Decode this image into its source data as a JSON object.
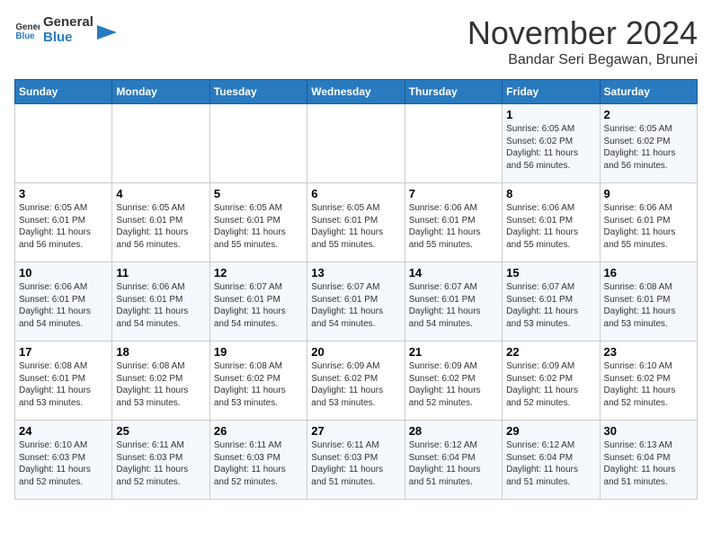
{
  "header": {
    "logo_line1": "General",
    "logo_line2": "Blue",
    "month": "November 2024",
    "location": "Bandar Seri Begawan, Brunei"
  },
  "weekdays": [
    "Sunday",
    "Monday",
    "Tuesday",
    "Wednesday",
    "Thursday",
    "Friday",
    "Saturday"
  ],
  "weeks": [
    [
      {
        "day": "",
        "info": ""
      },
      {
        "day": "",
        "info": ""
      },
      {
        "day": "",
        "info": ""
      },
      {
        "day": "",
        "info": ""
      },
      {
        "day": "",
        "info": ""
      },
      {
        "day": "1",
        "info": "Sunrise: 6:05 AM\nSunset: 6:02 PM\nDaylight: 11 hours\nand 56 minutes."
      },
      {
        "day": "2",
        "info": "Sunrise: 6:05 AM\nSunset: 6:02 PM\nDaylight: 11 hours\nand 56 minutes."
      }
    ],
    [
      {
        "day": "3",
        "info": "Sunrise: 6:05 AM\nSunset: 6:01 PM\nDaylight: 11 hours\nand 56 minutes."
      },
      {
        "day": "4",
        "info": "Sunrise: 6:05 AM\nSunset: 6:01 PM\nDaylight: 11 hours\nand 56 minutes."
      },
      {
        "day": "5",
        "info": "Sunrise: 6:05 AM\nSunset: 6:01 PM\nDaylight: 11 hours\nand 55 minutes."
      },
      {
        "day": "6",
        "info": "Sunrise: 6:05 AM\nSunset: 6:01 PM\nDaylight: 11 hours\nand 55 minutes."
      },
      {
        "day": "7",
        "info": "Sunrise: 6:06 AM\nSunset: 6:01 PM\nDaylight: 11 hours\nand 55 minutes."
      },
      {
        "day": "8",
        "info": "Sunrise: 6:06 AM\nSunset: 6:01 PM\nDaylight: 11 hours\nand 55 minutes."
      },
      {
        "day": "9",
        "info": "Sunrise: 6:06 AM\nSunset: 6:01 PM\nDaylight: 11 hours\nand 55 minutes."
      }
    ],
    [
      {
        "day": "10",
        "info": "Sunrise: 6:06 AM\nSunset: 6:01 PM\nDaylight: 11 hours\nand 54 minutes."
      },
      {
        "day": "11",
        "info": "Sunrise: 6:06 AM\nSunset: 6:01 PM\nDaylight: 11 hours\nand 54 minutes."
      },
      {
        "day": "12",
        "info": "Sunrise: 6:07 AM\nSunset: 6:01 PM\nDaylight: 11 hours\nand 54 minutes."
      },
      {
        "day": "13",
        "info": "Sunrise: 6:07 AM\nSunset: 6:01 PM\nDaylight: 11 hours\nand 54 minutes."
      },
      {
        "day": "14",
        "info": "Sunrise: 6:07 AM\nSunset: 6:01 PM\nDaylight: 11 hours\nand 54 minutes."
      },
      {
        "day": "15",
        "info": "Sunrise: 6:07 AM\nSunset: 6:01 PM\nDaylight: 11 hours\nand 53 minutes."
      },
      {
        "day": "16",
        "info": "Sunrise: 6:08 AM\nSunset: 6:01 PM\nDaylight: 11 hours\nand 53 minutes."
      }
    ],
    [
      {
        "day": "17",
        "info": "Sunrise: 6:08 AM\nSunset: 6:01 PM\nDaylight: 11 hours\nand 53 minutes."
      },
      {
        "day": "18",
        "info": "Sunrise: 6:08 AM\nSunset: 6:02 PM\nDaylight: 11 hours\nand 53 minutes."
      },
      {
        "day": "19",
        "info": "Sunrise: 6:08 AM\nSunset: 6:02 PM\nDaylight: 11 hours\nand 53 minutes."
      },
      {
        "day": "20",
        "info": "Sunrise: 6:09 AM\nSunset: 6:02 PM\nDaylight: 11 hours\nand 53 minutes."
      },
      {
        "day": "21",
        "info": "Sunrise: 6:09 AM\nSunset: 6:02 PM\nDaylight: 11 hours\nand 52 minutes."
      },
      {
        "day": "22",
        "info": "Sunrise: 6:09 AM\nSunset: 6:02 PM\nDaylight: 11 hours\nand 52 minutes."
      },
      {
        "day": "23",
        "info": "Sunrise: 6:10 AM\nSunset: 6:02 PM\nDaylight: 11 hours\nand 52 minutes."
      }
    ],
    [
      {
        "day": "24",
        "info": "Sunrise: 6:10 AM\nSunset: 6:03 PM\nDaylight: 11 hours\nand 52 minutes."
      },
      {
        "day": "25",
        "info": "Sunrise: 6:11 AM\nSunset: 6:03 PM\nDaylight: 11 hours\nand 52 minutes."
      },
      {
        "day": "26",
        "info": "Sunrise: 6:11 AM\nSunset: 6:03 PM\nDaylight: 11 hours\nand 52 minutes."
      },
      {
        "day": "27",
        "info": "Sunrise: 6:11 AM\nSunset: 6:03 PM\nDaylight: 11 hours\nand 51 minutes."
      },
      {
        "day": "28",
        "info": "Sunrise: 6:12 AM\nSunset: 6:04 PM\nDaylight: 11 hours\nand 51 minutes."
      },
      {
        "day": "29",
        "info": "Sunrise: 6:12 AM\nSunset: 6:04 PM\nDaylight: 11 hours\nand 51 minutes."
      },
      {
        "day": "30",
        "info": "Sunrise: 6:13 AM\nSunset: 6:04 PM\nDaylight: 11 hours\nand 51 minutes."
      }
    ]
  ]
}
